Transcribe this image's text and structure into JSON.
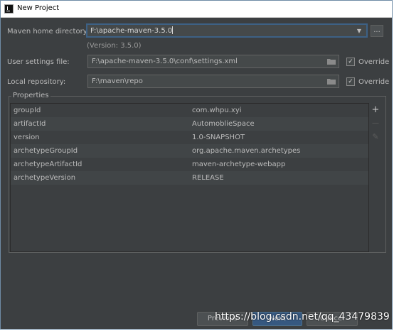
{
  "window": {
    "title": "New Project"
  },
  "maven_home": {
    "label": "Maven home directory:",
    "value": "F:\\apache-maven-3.5.0",
    "version": "(Version: 3.5.0)",
    "browse_label": "..."
  },
  "user_settings": {
    "label": "User settings file:",
    "value": "F:\\apache-maven-3.5.0\\conf\\settings.xml",
    "override_label": "Override",
    "override_checked": "✓"
  },
  "local_repo": {
    "label": "Local repository:",
    "value": "F:\\maven\\repo",
    "override_label": "Override",
    "override_checked": "✓"
  },
  "properties": {
    "title": "Properties",
    "rows": [
      {
        "key": "groupId",
        "value": "com.whpu.xyi"
      },
      {
        "key": "artifactId",
        "value": "AutomoblieSpace"
      },
      {
        "key": "version",
        "value": "1.0-SNAPSHOT"
      },
      {
        "key": "archetypeGroupId",
        "value": "org.apache.maven.archetypes"
      },
      {
        "key": "archetypeArtifactId",
        "value": "maven-archetype-webapp"
      },
      {
        "key": "archetypeVersion",
        "value": "RELEASE"
      }
    ],
    "add_glyph": "+",
    "remove_glyph": "—",
    "edit_glyph": "✎"
  },
  "buttons": {
    "previous": "Previous",
    "next": "Next",
    "cancel": "Cancel"
  },
  "watermark": "https://blog.csdn.net/qq_43479839",
  "colors": {
    "background": "#3c3f41",
    "focus_border": "#3d6185",
    "default_button": "#365880"
  }
}
